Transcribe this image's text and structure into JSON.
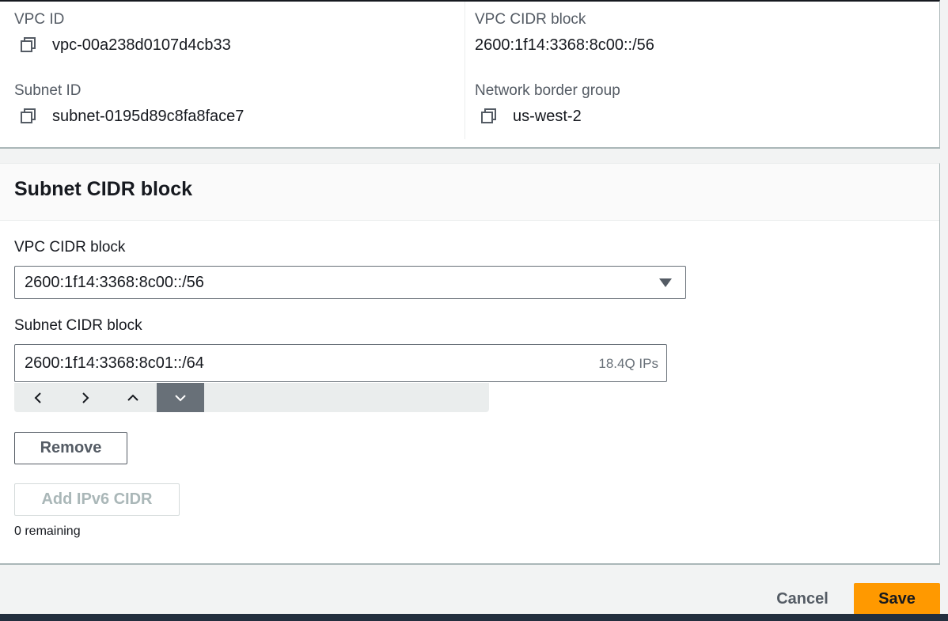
{
  "details": {
    "vpc_id_label": "VPC ID",
    "vpc_id_value": "vpc-00a238d0107d4cb33",
    "vpc_cidr_label": "VPC CIDR block",
    "vpc_cidr_value": "2600:1f14:3368:8c00::/56",
    "subnet_id_label": "Subnet ID",
    "subnet_id_value": "subnet-0195d89c8fa8face7",
    "border_group_label": "Network border group",
    "border_group_value": "us-west-2"
  },
  "cidr_section": {
    "title": "Subnet CIDR block",
    "vpc_cidr_select_label": "VPC CIDR block",
    "vpc_cidr_select_value": "2600:1f14:3368:8c00::/56",
    "subnet_cidr_label": "Subnet CIDR block",
    "subnet_cidr_value": "2600:1f14:3368:8c01::/64",
    "subnet_cidr_ips": "18.4Q IPs",
    "stepper_icons": [
      "chevron-left-icon",
      "chevron-right-icon",
      "chevron-up-icon",
      "chevron-down-icon"
    ],
    "remove_label": "Remove",
    "add_label": "Add IPv6 CIDR",
    "remaining_text": "0 remaining"
  },
  "footer": {
    "cancel_label": "Cancel",
    "save_label": "Save"
  },
  "colors": {
    "accent": "#ff9900",
    "text": "#16191f",
    "muted": "#545b64",
    "disabled": "#aab7b8"
  }
}
